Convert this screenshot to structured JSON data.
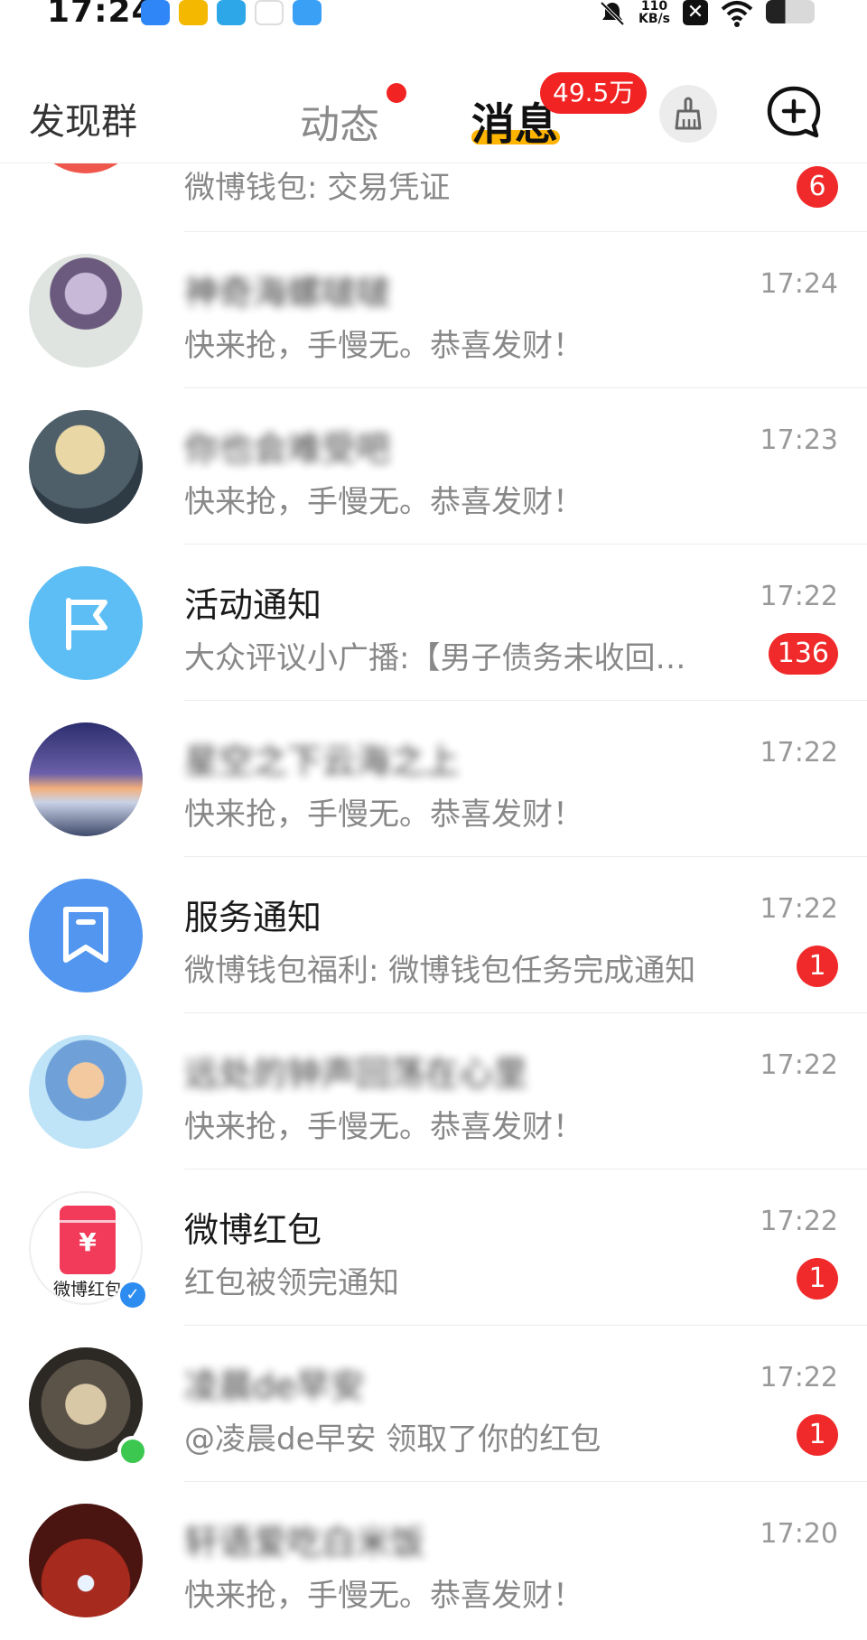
{
  "status": {
    "time": "17:24",
    "net_speed": "110",
    "net_unit": "KB/s",
    "x_icon": "✕"
  },
  "nav": {
    "discover": "发现群",
    "tab_dynamic": "动态",
    "tab_messages": "消息",
    "messages_badge": "49.5万"
  },
  "conversations": [
    {
      "title": "",
      "preview": "微博钱包: 交易凭证",
      "time": "",
      "badge": "6"
    },
    {
      "title": "神奇海螺啵啵",
      "preview": "快来抢，手慢无。恭喜发财！",
      "time": "17:24",
      "badge": ""
    },
    {
      "title": "你也会难受吧",
      "preview": "快来抢，手慢无。恭喜发财！",
      "time": "17:23",
      "badge": ""
    },
    {
      "title": "活动通知",
      "preview": "大众评议小广播:【男子债务未收回…",
      "time": "17:22",
      "badge": "136"
    },
    {
      "title": "星空之下云海之上",
      "preview": "快来抢，手慢无。恭喜发财！",
      "time": "17:22",
      "badge": ""
    },
    {
      "title": "服务通知",
      "preview": "微博钱包福利: 微博钱包任务完成通知",
      "time": "17:22",
      "badge": "1"
    },
    {
      "title": "远处的钟声回荡在心里",
      "preview": "快来抢，手慢无。恭喜发财！",
      "time": "17:22",
      "badge": ""
    },
    {
      "title": "微博红包",
      "preview": "红包被领完通知",
      "time": "17:22",
      "badge": "1",
      "avatar_caption": "微博红包"
    },
    {
      "title": "凌晨de早安",
      "preview": "@凌晨de早安 领取了你的红包",
      "time": "17:22",
      "badge": "1"
    },
    {
      "title": "轩语爱吃白米饭",
      "preview": "快来抢，手慢无。恭喜发财！",
      "time": "17:20",
      "badge": ""
    }
  ]
}
